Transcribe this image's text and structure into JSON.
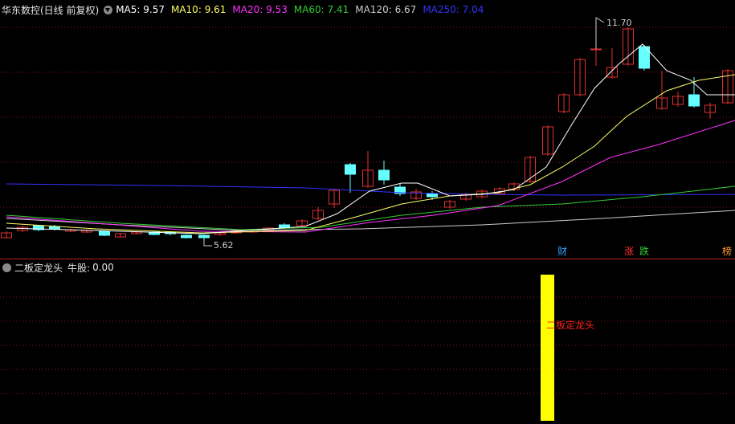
{
  "header": {
    "title": "华东数控(日线 前复权)",
    "ma": [
      {
        "label": "MA5:",
        "value": "9.57",
        "color": "#ffffff"
      },
      {
        "label": "MA10:",
        "value": "9.61",
        "color": "#ffff66"
      },
      {
        "label": "MA20:",
        "value": "9.53",
        "color": "#ff33ff"
      },
      {
        "label": "MA60:",
        "value": "7.41",
        "color": "#33cc33"
      },
      {
        "label": "MA120:",
        "value": "6.67",
        "color": "#cccccc"
      },
      {
        "label": "MA250:",
        "value": "7.04",
        "color": "#3333ff"
      }
    ]
  },
  "annotations": {
    "high_label": "11.70",
    "low_label": "5.62"
  },
  "events": [
    {
      "label": "财",
      "color": "#33a0ff"
    },
    {
      "label": "涨",
      "color": "#ff3333"
    },
    {
      "label": "跌",
      "color": "#33cc33"
    },
    {
      "label": "榜",
      "color": "#ff9933"
    }
  ],
  "sub_panel": {
    "title": "二板定龙头",
    "indicator_label": "牛股:",
    "indicator_value": "0.00",
    "signal_label": "二板定龙头",
    "signal_color": "#ffff00"
  },
  "colors": {
    "up": "#e03030",
    "down": "#66ffff",
    "grid": "#8b1a1a",
    "background": "#000000"
  }
}
